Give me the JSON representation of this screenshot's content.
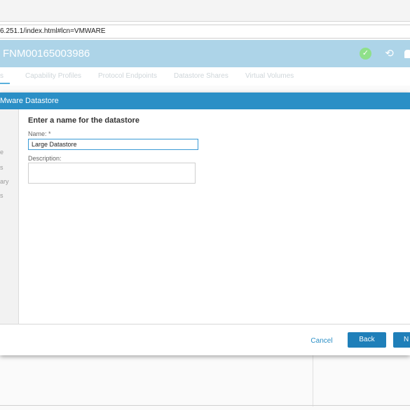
{
  "browser": {
    "url": "6.251.1/index.html#lcn=VMWARE"
  },
  "header": {
    "title": "FNM00165003986"
  },
  "tabs": [
    {
      "label": "s"
    },
    {
      "label": "Capability Profiles"
    },
    {
      "label": "Protocol Endpoints"
    },
    {
      "label": "Datastore Shares"
    },
    {
      "label": "Virtual Volumes"
    }
  ],
  "dialog": {
    "title": "Mware Datastore",
    "steps": [
      {
        "label": "e"
      },
      {
        "label": "s"
      },
      {
        "label": "ary"
      },
      {
        "label": "s"
      }
    ],
    "heading": "Enter a name for the datastore",
    "name_label": "Name: *",
    "name_value": "Large Datastore",
    "description_label": "Description:",
    "description_value": "",
    "cancel_label": "Cancel",
    "back_label": "Back",
    "next_label": "N"
  },
  "colors": {
    "header_bg": "#add4e8",
    "dialog_titlebar": "#2b8fc6",
    "primary_button": "#1f7fb9",
    "status_ok": "#8fe08a"
  },
  "icons": {
    "status": "check-circle-icon",
    "history": "history-icon",
    "notifications": "bell-icon"
  }
}
